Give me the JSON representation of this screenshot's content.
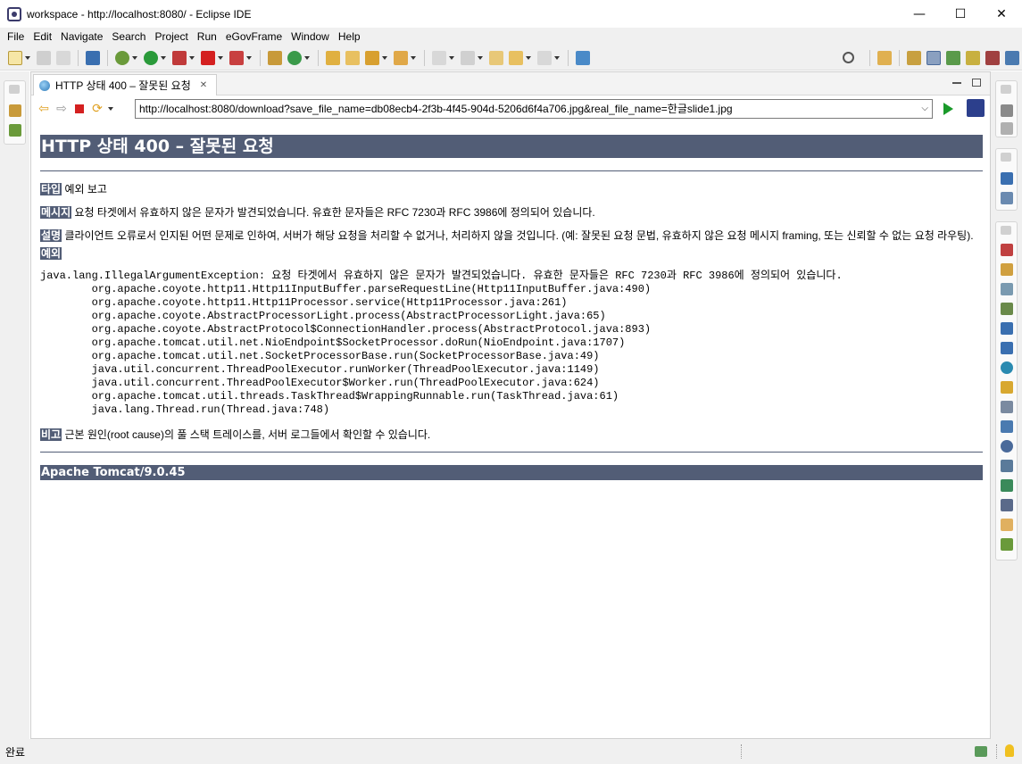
{
  "window": {
    "title": "workspace - http://localhost:8080/ - Eclipse IDE",
    "minimize": "—",
    "maximize": "☐",
    "close": "✕"
  },
  "menu": [
    "File",
    "Edit",
    "Navigate",
    "Search",
    "Project",
    "Run",
    "eGovFrame",
    "Window",
    "Help"
  ],
  "editor": {
    "tab_label": "HTTP 상태 400 – 잘못된 요청",
    "tab_close": "✕",
    "url": "http://localhost:8080/download?save_file_name=db08ecb4-2f3b-4f45-904d-5206d6f4a706.jpg&real_file_name=한글slide1.jpg"
  },
  "page": {
    "heading": "HTTP 상태 400 – 잘못된 요청",
    "type_label": "타입",
    "type_value": "예외 보고",
    "message_label": "메시지",
    "message_value": "요청 타겟에서 유효하지 않은 문자가 발견되었습니다. 유효한 문자들은 RFC 7230과 RFC 3986에 정의되어 있습니다.",
    "description_label": "설명",
    "description_value": "클라이언트 오류로서 인지된 어떤 문제로 인하여, 서버가 해당 요청을 처리할 수 없거나, 처리하지 않을 것입니다. (예: 잘못된 요청 문법, 유효하지 않은 요청 메시지 framing, 또는 신뢰할 수 없는 요청 라우팅).",
    "exception_label": "예외",
    "exception_text": "java.lang.IllegalArgumentException: 요청 타겟에서 유효하지 않은 문자가 발견되었습니다. 유효한 문자들은 RFC 7230과 RFC 3986에 정의되어 있습니다.",
    "stack": [
      "org.apache.coyote.http11.Http11InputBuffer.parseRequestLine(Http11InputBuffer.java:490)",
      "org.apache.coyote.http11.Http11Processor.service(Http11Processor.java:261)",
      "org.apache.coyote.AbstractProcessorLight.process(AbstractProcessorLight.java:65)",
      "org.apache.coyote.AbstractProtocol$ConnectionHandler.process(AbstractProtocol.java:893)",
      "org.apache.tomcat.util.net.NioEndpoint$SocketProcessor.doRun(NioEndpoint.java:1707)",
      "org.apache.tomcat.util.net.SocketProcessorBase.run(SocketProcessorBase.java:49)",
      "java.util.concurrent.ThreadPoolExecutor.runWorker(ThreadPoolExecutor.java:1149)",
      "java.util.concurrent.ThreadPoolExecutor$Worker.run(ThreadPoolExecutor.java:624)",
      "org.apache.tomcat.util.threads.TaskThread$WrappingRunnable.run(TaskThread.java:61)",
      "java.lang.Thread.run(Thread.java:748)"
    ],
    "note_label": "비고",
    "note_value": "근본 원인(root cause)의 풀 스택 트레이스를, 서버 로그들에서 확인할 수 있습니다.",
    "footer": "Apache Tomcat/9.0.45"
  },
  "status": {
    "text": "완료"
  },
  "colors": {
    "tomcat_header": "#525d76",
    "chrome": "#f0f0f0"
  }
}
